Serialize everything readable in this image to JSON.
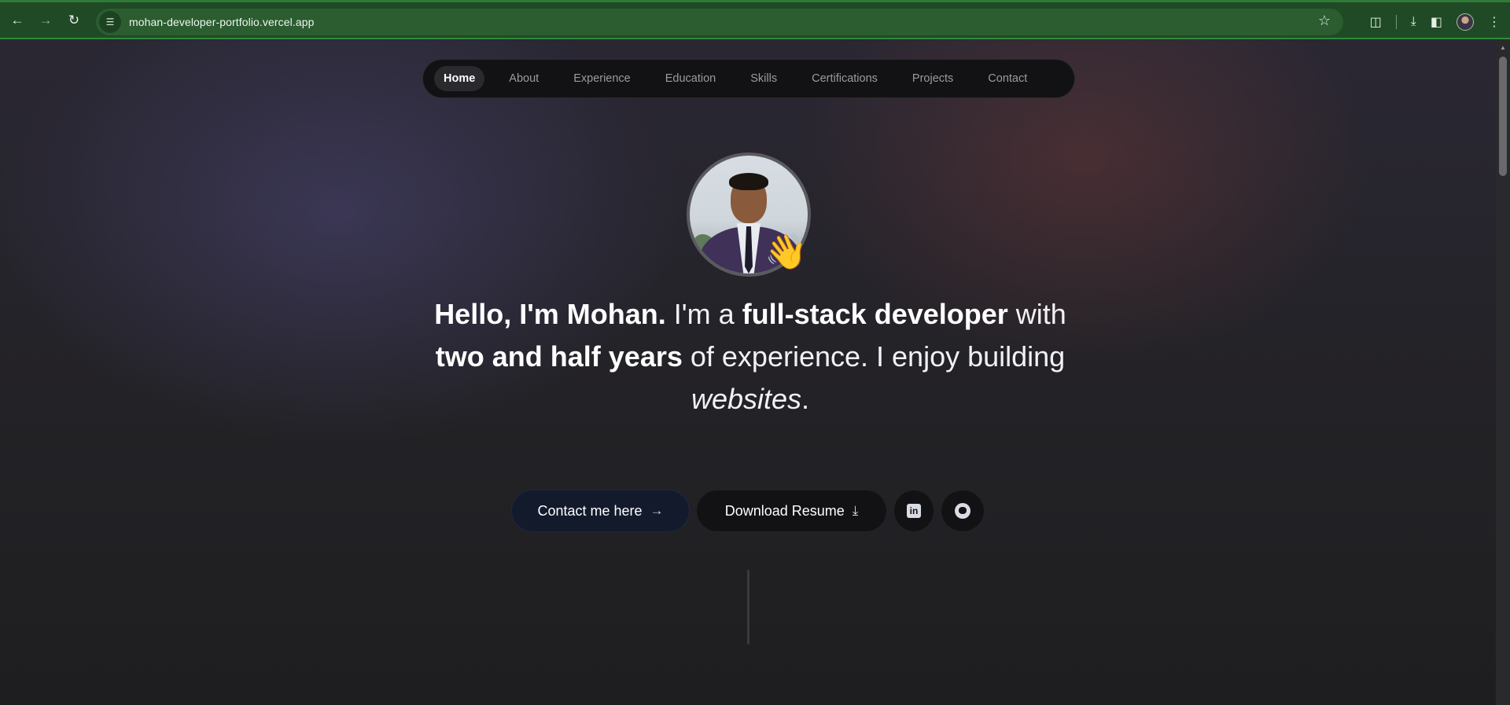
{
  "browser": {
    "url": "mohan-developer-portfolio.vercel.app",
    "icons": {
      "back": "arrow-left-icon",
      "forward": "arrow-right-icon",
      "reload": "reload-icon",
      "site_info": "tune-icon",
      "bookmark": "star-icon",
      "extensions": "puzzle-icon",
      "downloads": "download-icon",
      "side_panel": "side-panel-icon",
      "profile": "avatar",
      "menu": "more-vert-icon"
    },
    "colors": {
      "frame": "#1f4a25",
      "omnibox": "#2b5d30"
    }
  },
  "nav": {
    "items": [
      {
        "label": "Home",
        "active": true
      },
      {
        "label": "About",
        "active": false
      },
      {
        "label": "Experience",
        "active": false
      },
      {
        "label": "Education",
        "active": false
      },
      {
        "label": "Skills",
        "active": false
      },
      {
        "label": "Certifications",
        "active": false
      },
      {
        "label": "Projects",
        "active": false
      },
      {
        "label": "Contact",
        "active": false
      }
    ]
  },
  "hero": {
    "wave_emoji": "👋",
    "headline": {
      "part1_bold": "Hello, I'm Mohan.",
      "part2": " I'm a ",
      "part3_bold": "full-stack developer",
      "part4": " with ",
      "part5_bold": "two and half years",
      "part6": " of experience. I enjoy building ",
      "part7_italic": "websites",
      "part8": "."
    },
    "buttons": {
      "contact_label": "Contact me here",
      "contact_arrow": "→",
      "resume_label": "Download Resume",
      "resume_icon": "⤓",
      "linkedin_icon": "linkedin-icon",
      "github_icon": "github-icon"
    }
  }
}
